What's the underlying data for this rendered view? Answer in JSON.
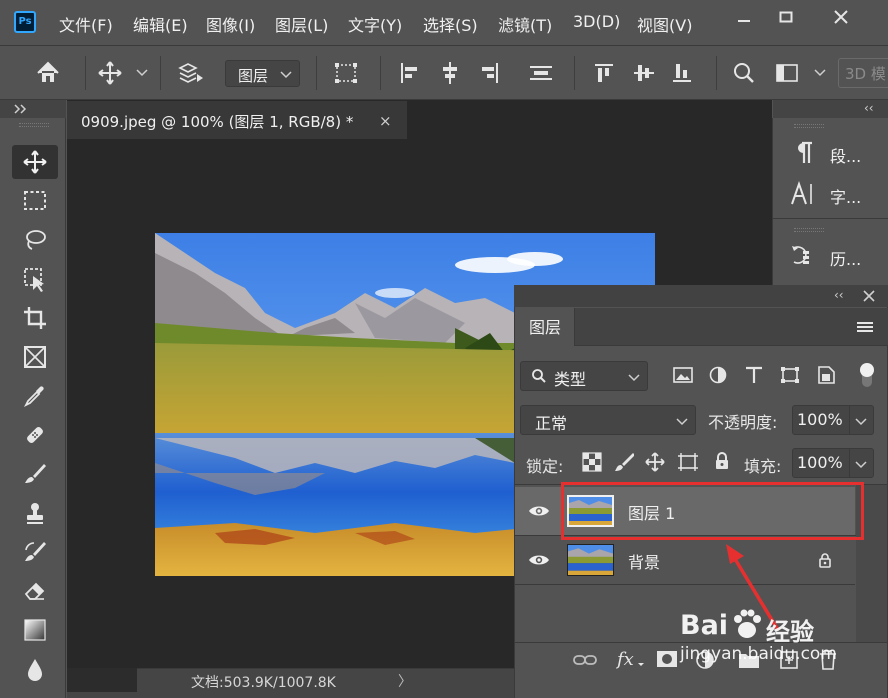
{
  "menu": {
    "app_logo": "Ps",
    "items": [
      "文件(F)",
      "编辑(E)",
      "图像(I)",
      "图层(L)",
      "文字(Y)",
      "选择(S)",
      "滤镜(T)",
      "3D(D)",
      "视图(V)"
    ]
  },
  "options": {
    "auto_select_target": "图层",
    "mode_3d": "3D 模"
  },
  "document": {
    "tab_title": "0909.jpeg @ 100% (图层 1, RGB/8) *",
    "close_symbol": "×",
    "status_text": "文档:503.9K/1007.8K",
    "status_arrow": "〉"
  },
  "dock": {
    "collapse_symbol": "‹‹",
    "items": [
      {
        "label": "段...",
        "icon": "paragraph-icon"
      },
      {
        "label": "字...",
        "icon": "character-icon"
      },
      {
        "label": "历...",
        "icon": "history-icon"
      }
    ]
  },
  "layers_panel": {
    "tab_label": "图层",
    "filter_kind": "类型",
    "blend_mode": "正常",
    "opacity_label": "不透明度:",
    "opacity_value": "100%",
    "lock_label": "锁定:",
    "fill_label": "填充:",
    "fill_value": "100%",
    "layers": [
      {
        "name": "图层 1",
        "selected": true,
        "visible": true,
        "locked": false
      },
      {
        "name": "背景",
        "selected": false,
        "visible": true,
        "locked": true
      }
    ]
  },
  "watermark": {
    "brand_left": "Bai",
    "brand_right": "经验",
    "url": "jingyan.baidu.com"
  },
  "colors": {
    "panel_bg": "#535353",
    "canvas_bg": "#282828",
    "highlight_red": "#e63030",
    "ps_blue": "#31a8ff"
  }
}
